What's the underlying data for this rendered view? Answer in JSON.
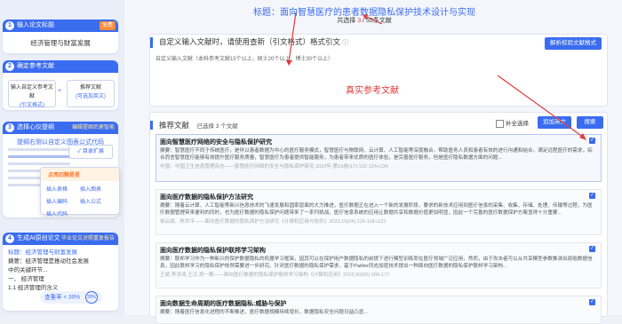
{
  "sidebar": {
    "step1": {
      "num": "1",
      "title": "输入论文标题",
      "tag": "免费",
      "value": "经济管理与财富发展"
    },
    "step2": {
      "num": "2",
      "title": "确定参考文献",
      "box1": {
        "line1": "输入自定义参考文献",
        "line2": "(引文格式)"
      },
      "box2": {
        "line1": "推荐文献",
        "line2": "(可选加英文)"
      }
    },
    "step3": {
      "num": "3",
      "title": "选择心仪提纲",
      "link": "编辑提纲后更智能",
      "subtitle": "提纲右侧以自定义图表公式代码",
      "check": "✓ 目录扩展",
      "popup": {
        "title": "点亮四颗星星",
        "items": [
          "插入表格",
          "插入图表",
          "插入编码",
          "插入公式",
          "插入代码"
        ]
      }
    },
    "step4": {
      "num": "4",
      "title": "生成AI原创论文",
      "link": "毕业论文对照重复报告",
      "lines": [
        "标题：经济管理与财富发展",
        "摘要：经济管理是推动社会发展",
        "中的关键环节...",
        "一、 经济管理",
        "1.1 经济管理的含义"
      ],
      "progress_label": "查重率 < 30%",
      "progress_value": "30%"
    }
  },
  "header": {
    "title": "标题：面向智慧医疗的患者数据隐私保护技术设计与实现",
    "count_prefix": "共选择",
    "count_selected": "3",
    "count_sep": " / ",
    "count_total": "55",
    "count_suffix": "条文献"
  },
  "custom": {
    "label": "自定义输入文献时，请使用查新（引文格式）格式引文",
    "parse_btn": "解析校验文献格式",
    "placeholder": "自定义输入文献（本科参考文献15个以上，硕士20个以上，博士30个以上）",
    "annotation": "真实参考文献"
  },
  "recommend": {
    "label": "推荐文献",
    "count": "已选择 3 个文献",
    "supp_label": "补全选择",
    "add_btn": "追加英文",
    "search_btn": "搜索",
    "refs": [
      {
        "title": "面向智慧医疗网络的安全与隐私保护研究",
        "abstract": "摘要：智慧医疗不同于传统医疗，是伴以患者数据为中心的医疗服务模式，智慧医疗与物联网、云计算、人工智能等深度融合，帮助医务人员和患者有效的进行沟通和结合，满足远程医疗的需求，综合而言智慧医疗能够有效提升医疗服务质量，智慧医疗为患者提供智能服务，为患者带来优质的医疗体验，是完善医疗服务，但是医疗隐私数据方面的问题...",
        "meta": "中国：中国卫生信息管理杂志——智慧医疗网络的安全与隐私保护研究 2022年,第19卷(17):122-124+134.",
        "checked": true
      },
      {
        "title": "面向医疗数据的隐私保护方法研究",
        "abstract": "摘要：随着云计算、人工智能等新兴信息技术的飞速发展和国家层面的大力推进，医疗数据正在进入一个新的发展阶段，要求的新技术应用到医疗信息的采集、收集、存储、处理、传输等过程，为医疗数据管理带来便利的同时，也为医疗数据的隐私保护问题带来了一系列挑战。医疗信息系统的应用让数据共享和数据价值更加明显，因此一个完善的医疗数据保护方案显得十分重要...",
        "meta": "徐云斌、陈世平——面向医疗数据的隐私保护方法研究《计算机应用与软件》2023,19(04):116-118+122.",
        "checked": true
      },
      {
        "title": "面向医疗数据的隐私保护联邦学习架构",
        "abstract": "摘要：联邦学习作为一种新兴的保护数据隐私的机器学习框架，因其可以在保护用户数据隐私的前提下进行模型训练而在医疗领域广泛应用，然而，由于攻击者可以从共享模型参数推测出原始数据信息，因此联邦学习的隐私保护依然需要进一步研究。针对医疗数据的隐私保护需求，基于Paillier同态加密技术提出一种面向医疗数据的隐私保护联邦学习架构...",
        "meta": "王斌,李洪涛,王汉,郑一鹏——面向医疗数据的隐私保护联邦学习架构《计算机应用》2023,50(05):166-177.",
        "checked": true
      },
      {
        "title": "面向数据生命周期的医疗数据隐私:威胁与保护",
        "abstract": "摘要：随着医疗信息化进程的不断推进，医疗数据规模持续增长，数据隐私安全问题日益凸显...",
        "meta": "",
        "checked": true
      }
    ]
  },
  "colors": {
    "accent": "#3a6cf0",
    "annotation": "#e23b3b"
  }
}
